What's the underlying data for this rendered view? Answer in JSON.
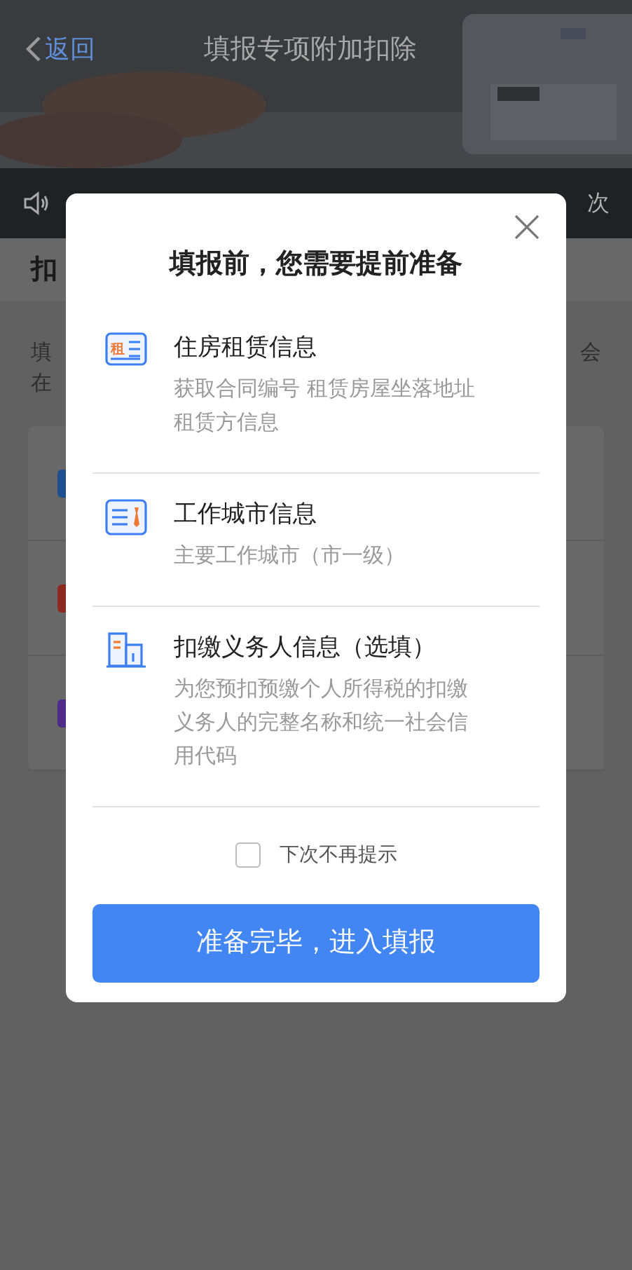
{
  "header": {
    "back": "返回",
    "title": "填报专项附加扣除"
  },
  "notice_bar": {
    "text": "次"
  },
  "section_title": "扣",
  "intro": {
    "lines": [
      "填",
      "在"
    ],
    "right": "会"
  },
  "list_items": [
    {
      "color": "#1f4f8e"
    },
    {
      "color": "#8c2a22"
    },
    {
      "color": "#4f2c8a"
    }
  ],
  "dialog": {
    "title": "填报前，您需要提前准备",
    "items": [
      {
        "kind": "rent",
        "icon_text": "租",
        "title": "住房租赁信息",
        "description": "获取合同编号 租赁房屋坐落地址租赁方信息"
      },
      {
        "kind": "city",
        "title": "工作城市信息",
        "description": "主要工作城市（市一级）"
      },
      {
        "kind": "employer",
        "title": "扣缴义务人信息（选填）",
        "description": "为您预扣预缴个人所得税的扣缴义务人的完整名称和统一社会信用代码"
      }
    ],
    "dont_remind": {
      "label": "下次不再提示",
      "checked": false
    },
    "confirm": "准备完毕，进入填报"
  }
}
